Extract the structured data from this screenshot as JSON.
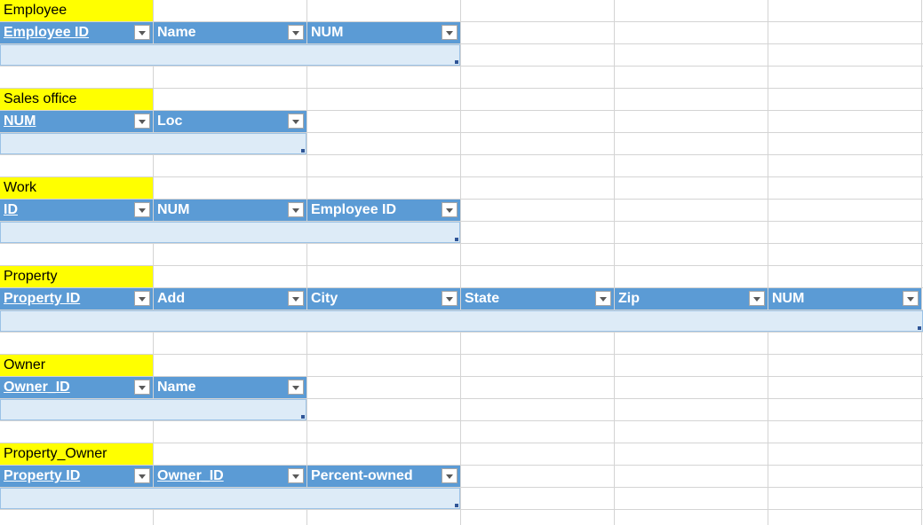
{
  "tables": [
    {
      "title": "Employee",
      "columns": [
        {
          "label": "Employee ID",
          "key": true
        },
        {
          "label": "Name",
          "key": false
        },
        {
          "label": "NUM",
          "key": false
        }
      ]
    },
    {
      "title": "Sales office",
      "columns": [
        {
          "label": "NUM",
          "key": true
        },
        {
          "label": "Loc",
          "key": false
        }
      ]
    },
    {
      "title": "Work",
      "columns": [
        {
          "label": "ID",
          "key": true
        },
        {
          "label": "NUM",
          "key": false
        },
        {
          "label": "Employee ID",
          "key": false
        }
      ]
    },
    {
      "title": "Property",
      "columns": [
        {
          "label": "Property ID",
          "key": true
        },
        {
          "label": "Add",
          "key": false
        },
        {
          "label": "City",
          "key": false
        },
        {
          "label": "State",
          "key": false
        },
        {
          "label": "Zip",
          "key": false
        },
        {
          "label": "NUM",
          "key": false
        }
      ]
    },
    {
      "title": "Owner",
      "columns": [
        {
          "label": "Owner_ID",
          "key": true
        },
        {
          "label": "Name",
          "key": false
        }
      ]
    },
    {
      "title": "Property_Owner",
      "columns": [
        {
          "label": "Property ID",
          "key": true
        },
        {
          "label": "Owner_ID",
          "key": true
        },
        {
          "label": "Percent-owned",
          "key": false
        }
      ]
    }
  ],
  "colors": {
    "title_fill": "#ffff00",
    "header_fill": "#5b9bd5",
    "row_fill": "#ddebf7"
  },
  "icons": {
    "filter": "chevron-down-icon"
  }
}
